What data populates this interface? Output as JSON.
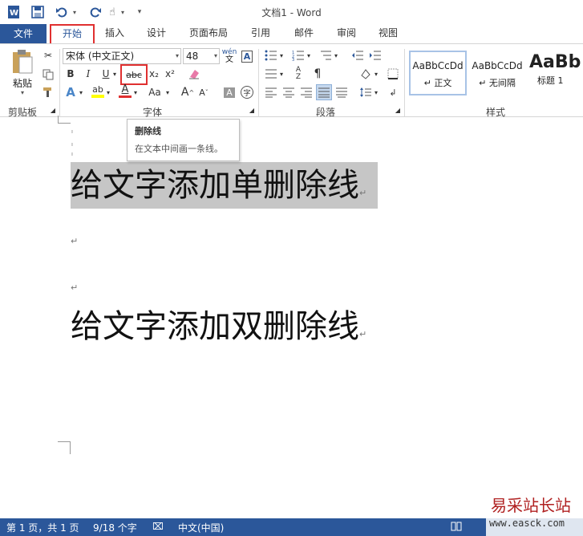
{
  "window": {
    "title": "文档1 - Word"
  },
  "tabs": {
    "file": "文件",
    "home": "开始",
    "insert": "插入",
    "design": "设计",
    "layout": "页面布局",
    "references": "引用",
    "mailings": "邮件",
    "review": "审阅",
    "view": "视图"
  },
  "ribbon": {
    "clipboard": {
      "paste": "粘贴",
      "label": "剪贴板"
    },
    "font": {
      "name": "宋体 (中文正文)",
      "size": "48",
      "label": "字体",
      "bold": "B",
      "italic": "I",
      "underline": "U",
      "strikethrough": "abc",
      "subscript": "x₂",
      "superscript": "x²",
      "font_color": "A",
      "case": "Aa",
      "grow": "A",
      "shrink": "A",
      "char_shade": "A",
      "phonetic": "wén",
      "enclose": "字"
    },
    "paragraph": {
      "label": "段落"
    },
    "styles": {
      "label": "样式",
      "items": [
        {
          "preview": "AaBbCcDd",
          "name": "↵ 正文"
        },
        {
          "preview": "AaBbCcDd",
          "name": "↵ 无间隔"
        },
        {
          "preview": "AaBb",
          "name": "标题 1"
        }
      ]
    }
  },
  "tooltip": {
    "title": "删除线",
    "desc": "在文本中间画一条线。"
  },
  "document": {
    "line1": "给文字添加单删除线",
    "line2": "给文字添加双删除线",
    "para_mark": "↵"
  },
  "status": {
    "page": "第 1 页，共 1 页",
    "words": "9/18 个字",
    "language": "中文(中国)"
  },
  "watermark": {
    "cn": "易采站长站",
    "url": "www.easck.com"
  },
  "colors": {
    "accent": "#2b579a",
    "highlight": "#e03030",
    "selection": "#c6c6c6"
  }
}
